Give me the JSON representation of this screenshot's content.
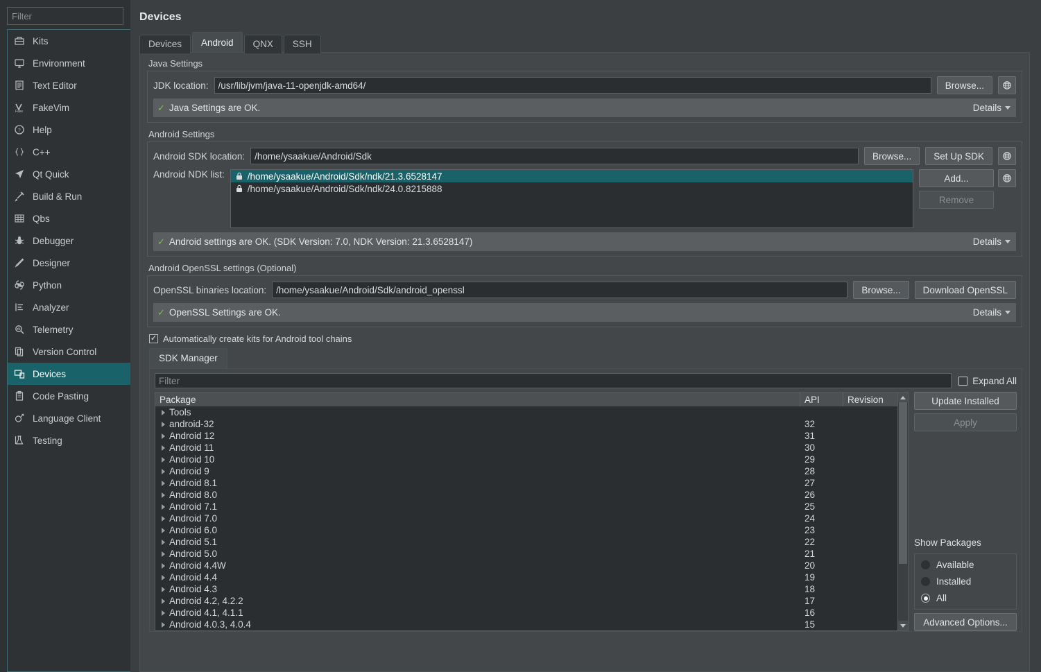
{
  "sidebar": {
    "filter_placeholder": "Filter",
    "items": [
      {
        "label": "Kits",
        "icon": "kits-icon",
        "selected": false
      },
      {
        "label": "Environment",
        "icon": "monitor-icon",
        "selected": false
      },
      {
        "label": "Text Editor",
        "icon": "text-editor-icon",
        "selected": false
      },
      {
        "label": "FakeVim",
        "icon": "fakevim-icon",
        "selected": false
      },
      {
        "label": "Help",
        "icon": "help-icon",
        "selected": false
      },
      {
        "label": "C++",
        "icon": "braces-icon",
        "selected": false
      },
      {
        "label": "Qt Quick",
        "icon": "qtquick-icon",
        "selected": false
      },
      {
        "label": "Build & Run",
        "icon": "hammer-icon",
        "selected": false
      },
      {
        "label": "Qbs",
        "icon": "grid-icon",
        "selected": false
      },
      {
        "label": "Debugger",
        "icon": "bug-icon",
        "selected": false
      },
      {
        "label": "Designer",
        "icon": "pencil-icon",
        "selected": false
      },
      {
        "label": "Python",
        "icon": "python-icon",
        "selected": false
      },
      {
        "label": "Analyzer",
        "icon": "analyzer-icon",
        "selected": false
      },
      {
        "label": "Telemetry",
        "icon": "telemetry-icon",
        "selected": false
      },
      {
        "label": "Version Control",
        "icon": "version-control-icon",
        "selected": false
      },
      {
        "label": "Devices",
        "icon": "devices-icon",
        "selected": true
      },
      {
        "label": "Code Pasting",
        "icon": "clipboard-icon",
        "selected": false
      },
      {
        "label": "Language Client",
        "icon": "language-client-icon",
        "selected": false
      },
      {
        "label": "Testing",
        "icon": "testing-icon",
        "selected": false
      }
    ]
  },
  "page": {
    "title": "Devices",
    "tabs": [
      {
        "label": "Devices",
        "active": false
      },
      {
        "label": "Android",
        "active": true
      },
      {
        "label": "QNX",
        "active": false
      },
      {
        "label": "SSH",
        "active": false
      }
    ]
  },
  "java_settings": {
    "group_title": "Java Settings",
    "jdk_label": "JDK location:",
    "jdk_value": "/usr/lib/jvm/java-11-openjdk-amd64/",
    "browse_label": "Browse...",
    "web_icon": "globe-icon",
    "status_text": "Java Settings are OK.",
    "details_label": "Details"
  },
  "android_settings": {
    "group_title": "Android Settings",
    "sdk_label": "Android SDK location:",
    "sdk_value": "/home/ysaakue/Android/Sdk",
    "browse_label": "Browse...",
    "setup_sdk_label": "Set Up SDK",
    "ndk_label": "Android NDK list:",
    "ndk_items": [
      {
        "path": "/home/ysaakue/Android/Sdk/ndk/21.3.6528147",
        "locked": true,
        "selected": true
      },
      {
        "path": "/home/ysaakue/Android/Sdk/ndk/24.0.8215888",
        "locked": true,
        "selected": false
      }
    ],
    "add_label": "Add...",
    "remove_label": "Remove",
    "remove_disabled": true,
    "status_text": "Android settings are OK. (SDK Version: 7.0, NDK Version: 21.3.6528147)",
    "details_label": "Details"
  },
  "openssl_settings": {
    "group_title": "Android OpenSSL settings (Optional)",
    "binaries_label": "OpenSSL binaries location:",
    "binaries_value": "/home/ysaakue/Android/Sdk/android_openssl",
    "browse_label": "Browse...",
    "download_label": "Download OpenSSL",
    "status_text": "OpenSSL Settings are OK.",
    "details_label": "Details"
  },
  "auto_kits": {
    "label": "Automatically create kits for Android tool chains",
    "checked": true,
    "check_glyph": "✓"
  },
  "sdk_manager": {
    "tab_label": "SDK Manager",
    "filter_placeholder": "Filter",
    "expand_all_label": "Expand All",
    "expand_all_checked": false,
    "columns": [
      "Package",
      "API",
      "Revision"
    ],
    "rows": [
      {
        "package": "Tools",
        "api": "",
        "revision": ""
      },
      {
        "package": "android-32",
        "api": "32",
        "revision": ""
      },
      {
        "package": "Android 12",
        "api": "31",
        "revision": ""
      },
      {
        "package": "Android 11",
        "api": "30",
        "revision": ""
      },
      {
        "package": "Android 10",
        "api": "29",
        "revision": ""
      },
      {
        "package": "Android 9",
        "api": "28",
        "revision": ""
      },
      {
        "package": "Android 8.1",
        "api": "27",
        "revision": ""
      },
      {
        "package": "Android 8.0",
        "api": "26",
        "revision": ""
      },
      {
        "package": "Android 7.1",
        "api": "25",
        "revision": ""
      },
      {
        "package": "Android 7.0",
        "api": "24",
        "revision": ""
      },
      {
        "package": "Android 6.0",
        "api": "23",
        "revision": ""
      },
      {
        "package": "Android 5.1",
        "api": "22",
        "revision": ""
      },
      {
        "package": "Android 5.0",
        "api": "21",
        "revision": ""
      },
      {
        "package": "Android 4.4W",
        "api": "20",
        "revision": ""
      },
      {
        "package": "Android 4.4",
        "api": "19",
        "revision": ""
      },
      {
        "package": "Android 4.3",
        "api": "18",
        "revision": ""
      },
      {
        "package": "Android 4.2, 4.2.2",
        "api": "17",
        "revision": ""
      },
      {
        "package": "Android 4.1, 4.1.1",
        "api": "16",
        "revision": ""
      },
      {
        "package": "Android 4.0.3, 4.0.4",
        "api": "15",
        "revision": ""
      }
    ],
    "update_installed_label": "Update Installed",
    "apply_label": "Apply",
    "apply_disabled": true,
    "show_packages_title": "Show Packages",
    "show_packages_options": [
      {
        "label": "Available",
        "selected": false
      },
      {
        "label": "Installed",
        "selected": false
      },
      {
        "label": "All",
        "selected": true
      }
    ],
    "advanced_options_label": "Advanced Options..."
  },
  "colors": {
    "selection": "#196269",
    "status_ok": "#7fc04a",
    "panel_bg": "#434749",
    "window_bg": "#3b3f41",
    "sidebar_bg": "#2f3234",
    "input_bg": "#2b2e30"
  }
}
